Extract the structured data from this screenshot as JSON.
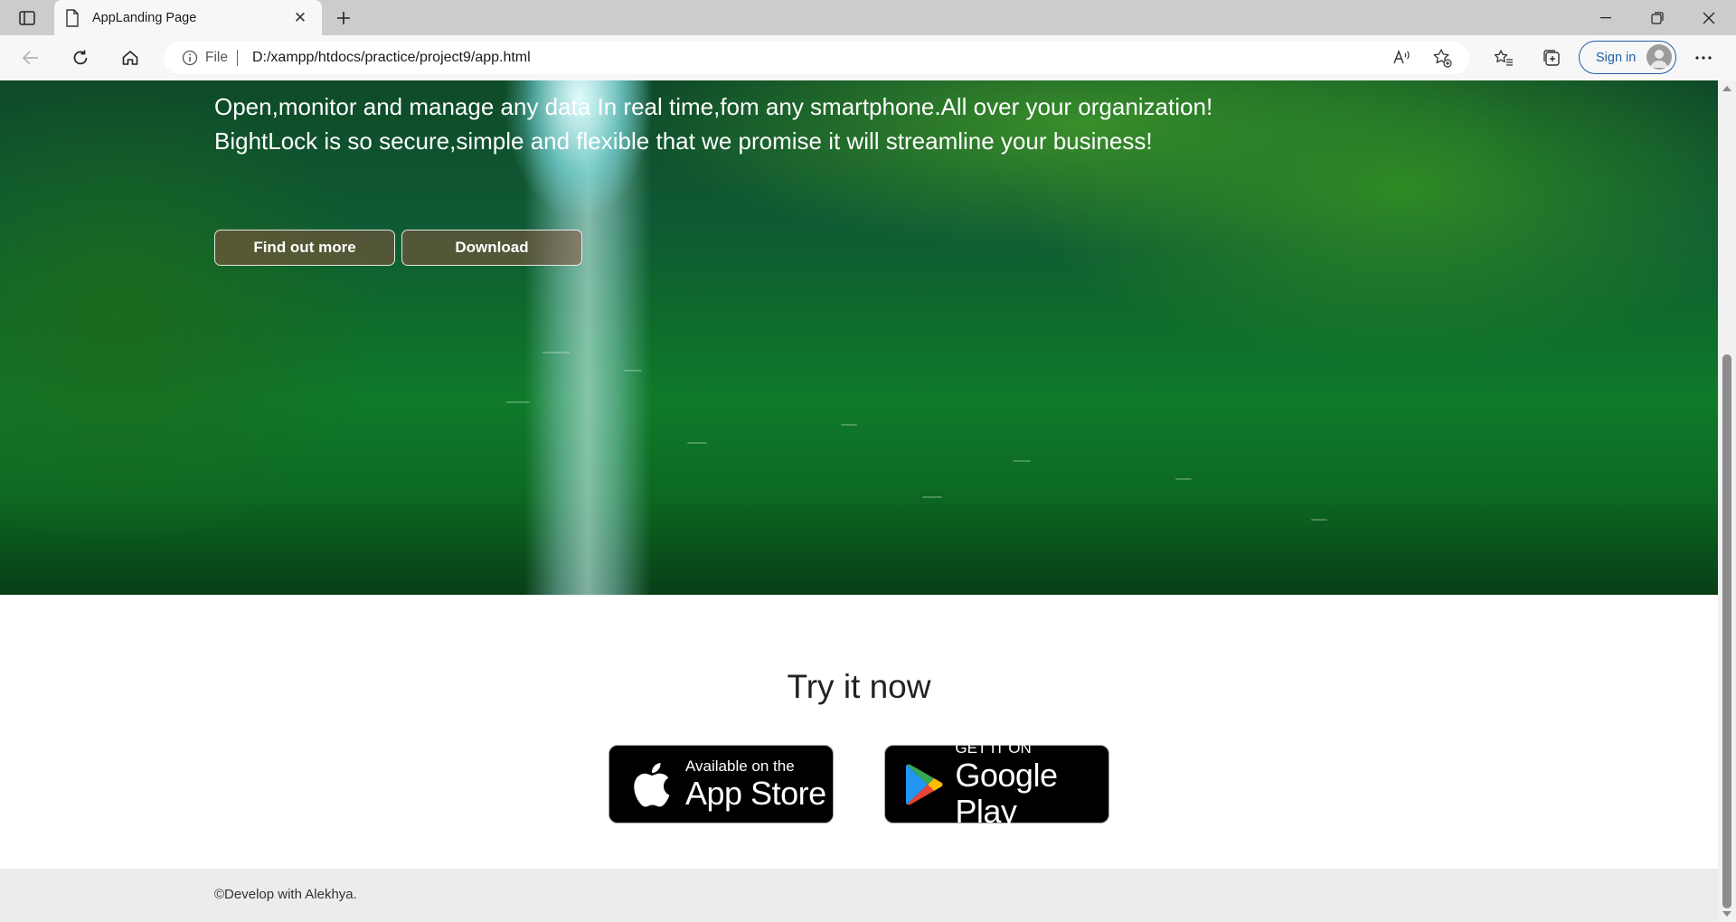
{
  "browser": {
    "tab_title": "AppLanding Page",
    "address_protocol": "File",
    "address_url": "D:/xampp/htdocs/practice/project9/app.html",
    "sign_in_label": "Sign in"
  },
  "hero": {
    "line1": "Open,monitor and manage any data In real time,fom any smartphone.All over your organization!",
    "line2": "BightLock is so secure,simple and flexible that we promise it will streamline your business!",
    "find_out_more_label": "Find out more",
    "download_label": "Download"
  },
  "try_section": {
    "title": "Try it now",
    "app_store": {
      "small": "Available on the",
      "big": "App Store"
    },
    "google_play": {
      "small": "GET IT ON",
      "big": "Google Play"
    }
  },
  "footer": {
    "text": "©Develop with Alekhya."
  },
  "colors": {
    "hero_green": "#0e6a2c",
    "button_fill": "#8c503c",
    "signin_blue": "#1f5fa8",
    "footer_bg": "#ececec"
  }
}
